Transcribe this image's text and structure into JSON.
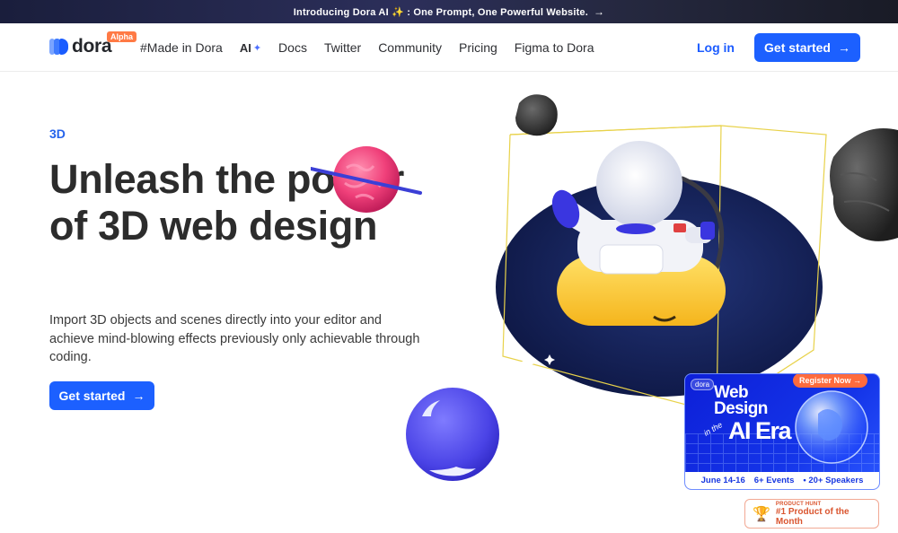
{
  "banner": {
    "text": "Introducing Dora AI ✨ : One Prompt, One Powerful Website.",
    "arrow": "→"
  },
  "nav": {
    "logo_text": "dora",
    "badge": "Alpha",
    "links": [
      "#Made in Dora",
      "AI",
      "Docs",
      "Twitter",
      "Community",
      "Pricing",
      "Figma to Dora"
    ],
    "login": "Log in",
    "cta": "Get started",
    "cta_arrow": "→"
  },
  "hero": {
    "eyebrow": "3D",
    "title": "Unleash the power of 3D web design",
    "description": "Import 3D objects and scenes directly into your editor and achieve mind-blowing effects previously only achievable through coding.",
    "cta": "Get started",
    "cta_arrow": "→"
  },
  "promo": {
    "tag": "dora",
    "register": "Register Now →",
    "line1": "Web",
    "line2": "Design",
    "line3": "in the",
    "line4": "AI Era",
    "footer": [
      "June 14-16",
      "6+ Events",
      "• 20+ Speakers"
    ]
  },
  "product_hunt": {
    "small": "PRODUCT HUNT",
    "big": "#1 Product of the Month"
  },
  "colors": {
    "primary": "#1c60ff",
    "eyebrow": "#2563eb",
    "alpha_badge": "#ff7a45",
    "register": "#ff6b3d"
  },
  "icons": [
    "dora-logo-icon",
    "sparkle-icon",
    "arrow-right-icon",
    "trophy-icon"
  ]
}
